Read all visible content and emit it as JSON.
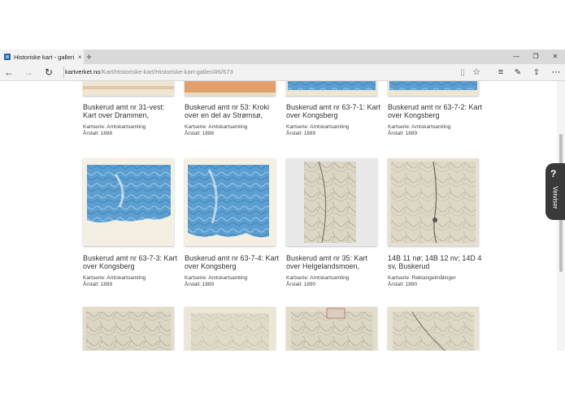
{
  "browser": {
    "tab_title": "Historiske kart - galleri |",
    "tab_close": "×",
    "new_tab": "+",
    "url_host": "kartverket.no",
    "url_path": "/Kart/Historiske-kart/Historiske-kart-galleri/#6/673",
    "window_controls": [
      "—",
      "❐",
      "✕"
    ]
  },
  "side_widget": {
    "symbol": "?",
    "label": "Veiviser"
  },
  "cards": [
    {
      "title": "Buskerud amt nr 31-vest: Kart over Drammen,",
      "series": "Kartserie: Amtskartsamling",
      "year": "Årstall: 1888",
      "thumb": "beige-top"
    },
    {
      "title": "Buskerud amt nr 53: Kroki over en del av Strømsø,",
      "series": "Kartserie: Amtskartsamling",
      "year": "Årstall: 1888",
      "thumb": "orange-top"
    },
    {
      "title": "Buskerud amt nr 63-7-1: Kart over Kongsberg",
      "series": "Kartserie: Amtskartsamling",
      "year": "Årstall: 1889",
      "thumb": "blue-top"
    },
    {
      "title": "Buskerud amt nr 63-7-2: Kart over Kongsberg",
      "series": "Kartserie: Amtskartsamling",
      "year": "Årstall: 1889",
      "thumb": "blue-top"
    },
    {
      "title": "Buskerud amt nr 63-7-3: Kart over Kongsberg",
      "series": "Kartserie: Amtskartsamling",
      "year": "Årstall: 1889",
      "thumb": "blue"
    },
    {
      "title": "Buskerud amt nr 63-7-4: Kart over Kongsberg",
      "series": "Kartserie: Amtskartsamling",
      "year": "Årstall: 1889",
      "thumb": "blue"
    },
    {
      "title": "Buskerud amt nr 35: Kart over Helgelandsmoen,",
      "series": "Kartserie: Amtskartsamling",
      "year": "Årstall: 1890",
      "thumb": "gray"
    },
    {
      "title": "14B 11 nø; 14B 12 nv; 14D 4 sv, Buskerud",
      "series": "Kartserie: Rektangelmålinger",
      "year": "Årstall: 1890",
      "thumb": "gray"
    },
    {
      "title": "",
      "series": "",
      "year": "",
      "thumb": "gray"
    },
    {
      "title": "",
      "series": "",
      "year": "",
      "thumb": "gray"
    },
    {
      "title": "",
      "series": "",
      "year": "",
      "thumb": "gray"
    },
    {
      "title": "",
      "series": "",
      "year": "",
      "thumb": "gray"
    }
  ]
}
